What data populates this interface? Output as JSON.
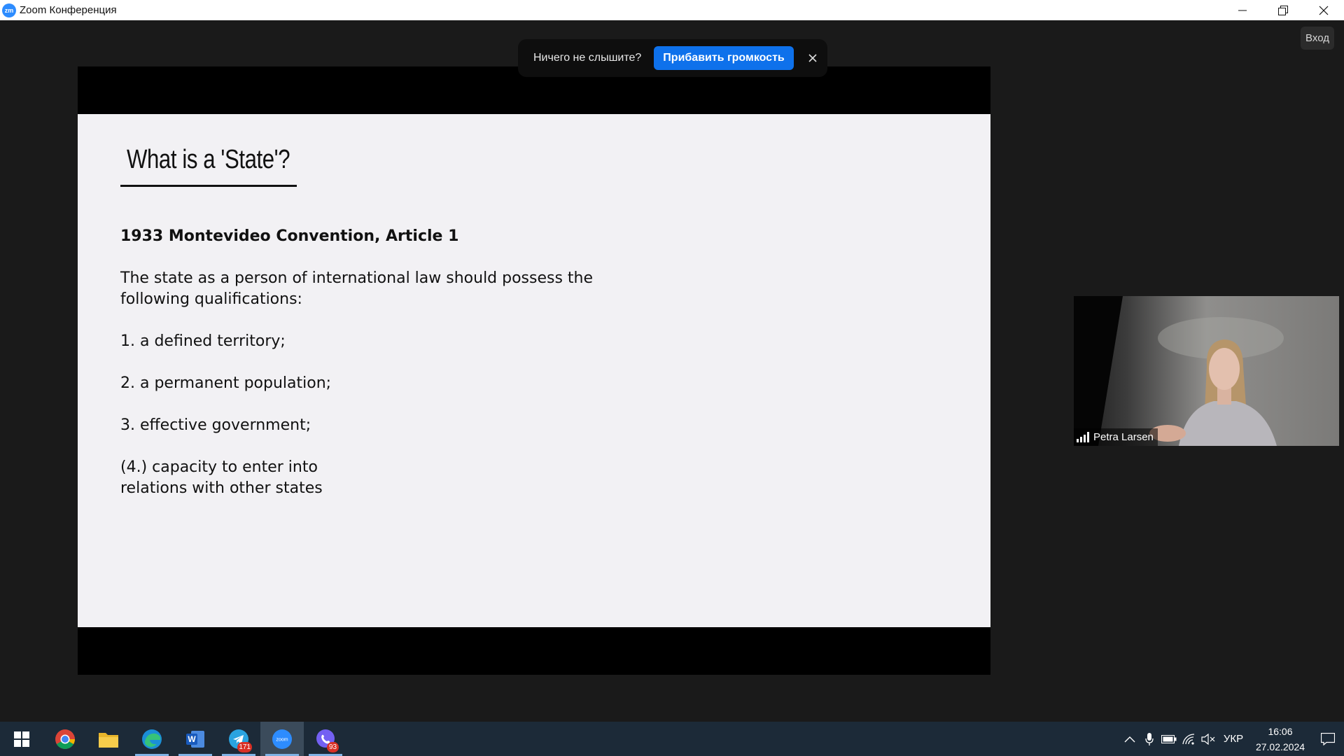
{
  "window": {
    "app_logo": "zm",
    "title": "Zoom Конференция",
    "controls": [
      "minimize-icon",
      "restore-icon",
      "close-icon"
    ]
  },
  "top_right": {
    "login_label": "Вход"
  },
  "audio_banner": {
    "text": "Ничего не слышите?",
    "button_label": "Прибавить громкость",
    "close_icon": "close-icon"
  },
  "slide": {
    "title": "What is a 'State'?",
    "heading": "1933 Montevideo Convention, Article 1",
    "intro_line1": "The state as a person of international law should possess the",
    "intro_line2": "following qualifications:",
    "items": [
      "1. a defined territory;",
      "2. a permanent population;",
      "3. effective government;"
    ],
    "item4_line1": "(4.) capacity to enter into",
    "item4_line2": "relations with other states"
  },
  "participant": {
    "name": "Petra Larsen",
    "signal_icon": "signal-bars-icon"
  },
  "taskbar": {
    "apps": [
      {
        "name": "start-icon"
      },
      {
        "name": "chrome-icon"
      },
      {
        "name": "file-explorer-icon"
      },
      {
        "name": "edge-icon"
      },
      {
        "name": "word-icon",
        "label": "W"
      },
      {
        "name": "telegram-icon",
        "badge": "171"
      },
      {
        "name": "zoom-icon",
        "label": "zoom"
      },
      {
        "name": "viber-icon",
        "badge": "93"
      }
    ],
    "tray": {
      "icons": [
        "chevron-up-icon",
        "microphone-icon",
        "battery-icon",
        "wifi-icon",
        "speaker-muted-icon"
      ],
      "language": "УКР",
      "time": "16:06",
      "date": "27.02.2024",
      "notification_icon": "notification-icon"
    }
  },
  "colors": {
    "zoom_blue": "#2d8cff",
    "banner_button": "#0e71eb",
    "taskbar": "#1c2a38",
    "background": "#1a1a1a"
  }
}
